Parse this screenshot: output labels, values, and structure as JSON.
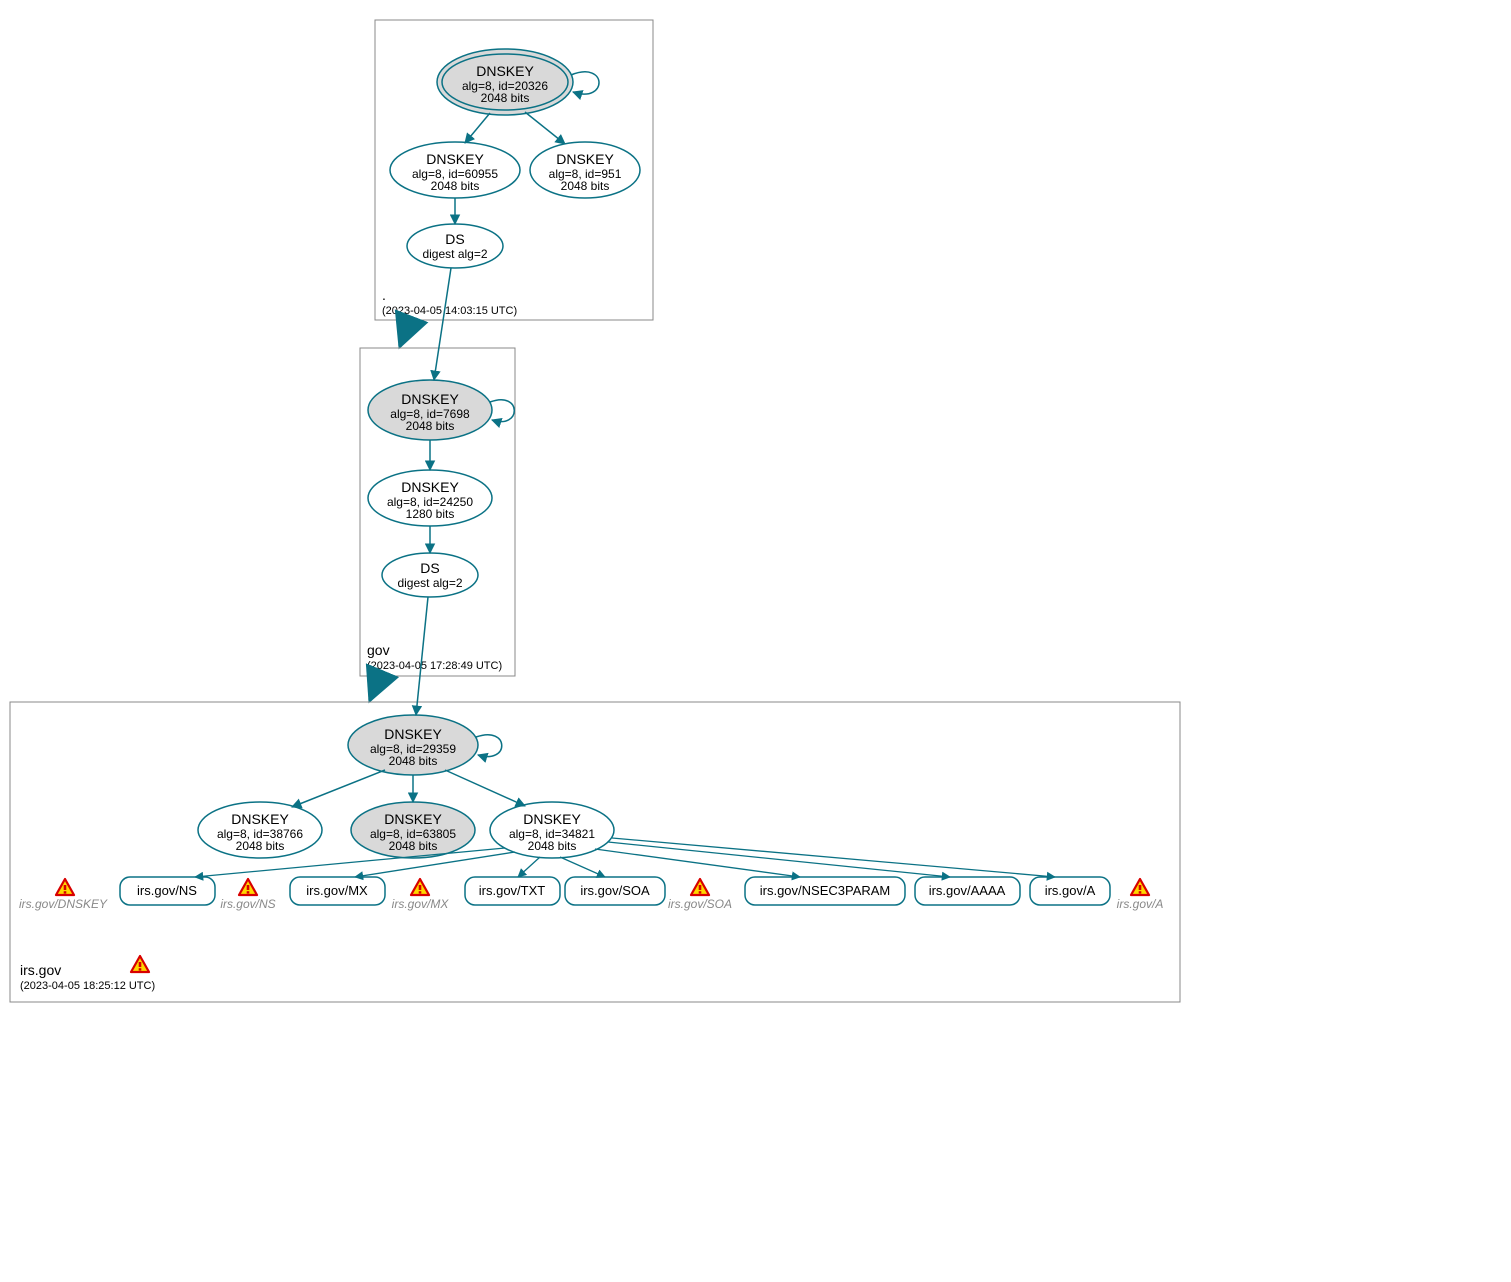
{
  "colors": {
    "teal": "#0b7285",
    "grey_fill": "#d9d9d9",
    "warn_red": "#d80000",
    "warn_yellow": "#ffd700",
    "border_grey": "#888888"
  },
  "zones": {
    "root": {
      "label_name": ".",
      "label_ts": "(2023-04-05 14:03:15 UTC)",
      "ksk": {
        "title": "DNSKEY",
        "line2": "alg=8, id=20326",
        "line3": "2048 bits",
        "filled": true,
        "double": true
      },
      "zsk": {
        "title": "DNSKEY",
        "line2": "alg=8, id=60955",
        "line3": "2048 bits"
      },
      "standby": {
        "title": "DNSKEY",
        "line2": "alg=8, id=951",
        "line3": "2048 bits"
      },
      "ds": {
        "title": "DS",
        "line2": "digest alg=2"
      }
    },
    "gov": {
      "label_name": "gov",
      "label_ts": "(2023-04-05 17:28:49 UTC)",
      "ksk": {
        "title": "DNSKEY",
        "line2": "alg=8, id=7698",
        "line3": "2048 bits",
        "filled": true
      },
      "zsk": {
        "title": "DNSKEY",
        "line2": "alg=8, id=24250",
        "line3": "1280 bits"
      },
      "ds": {
        "title": "DS",
        "line2": "digest alg=2"
      }
    },
    "irs": {
      "label_name": "irs.gov",
      "label_ts": "(2023-04-05 18:25:12 UTC)",
      "ksk": {
        "title": "DNSKEY",
        "line2": "alg=8, id=29359",
        "line3": "2048 bits",
        "filled": true
      },
      "zsk1": {
        "title": "DNSKEY",
        "line2": "alg=8, id=38766",
        "line3": "2048 bits"
      },
      "zsk2": {
        "title": "DNSKEY",
        "line2": "alg=8, id=63805",
        "line3": "2048 bits",
        "filled": true
      },
      "zsk3": {
        "title": "DNSKEY",
        "line2": "alg=8, id=34821",
        "line3": "2048 bits"
      }
    }
  },
  "records": {
    "ns": "irs.gov/NS",
    "mx": "irs.gov/MX",
    "txt": "irs.gov/TXT",
    "soa": "irs.gov/SOA",
    "nsec3param": "irs.gov/NSEC3PARAM",
    "aaaa": "irs.gov/AAAA",
    "a": "irs.gov/A"
  },
  "warnings": {
    "dnskey": "irs.gov/DNSKEY",
    "ns": "irs.gov/NS",
    "mx": "irs.gov/MX",
    "soa": "irs.gov/SOA",
    "a": "irs.gov/A"
  }
}
